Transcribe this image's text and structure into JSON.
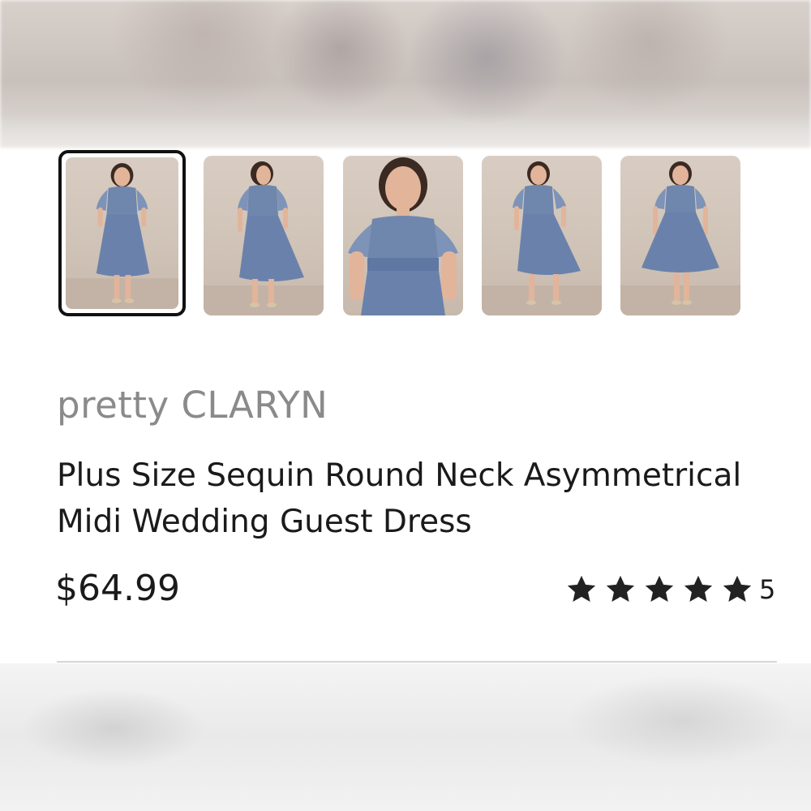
{
  "product": {
    "brand": "pretty CLARYN",
    "title": "Plus Size Sequin Round Neck Asymmetrical Midi Wedding Guest Dress",
    "price": "$64.99",
    "rating": {
      "stars": 5,
      "count": "5"
    }
  },
  "thumbnails": [
    {
      "name": "front view",
      "selected": true
    },
    {
      "name": "back view",
      "selected": false
    },
    {
      "name": "close-up view",
      "selected": false
    },
    {
      "name": "side view",
      "selected": false
    },
    {
      "name": "full front view",
      "selected": false
    }
  ],
  "colors": {
    "dress": "#6f86ad",
    "selected_border": "#111111",
    "star": "#222222",
    "brand_text": "#8a8a8a"
  }
}
